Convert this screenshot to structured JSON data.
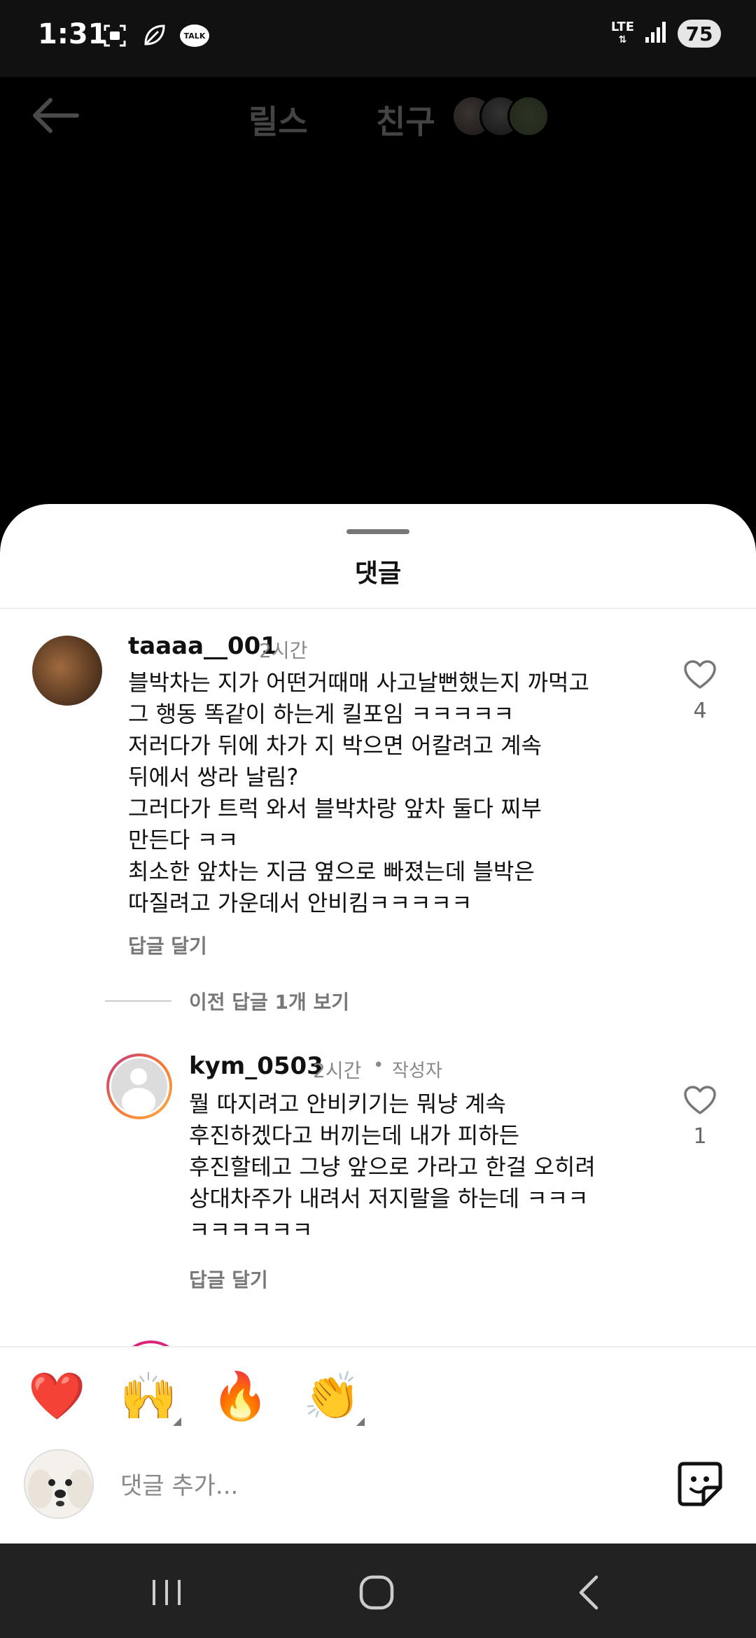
{
  "status_bar": {
    "time": "1:31",
    "talk_label": "TALK",
    "network": "LTE",
    "battery": "75"
  },
  "top_nav": {
    "reels_label": "릴스",
    "friends_label": "친구"
  },
  "sheet": {
    "title": "댓글"
  },
  "comments": [
    {
      "username": "taaaa__001",
      "time": "2시간",
      "text": "블박차는 지가 어떤거때매 사고날뻔했는지 까먹고\n그 행동 똑같이 하는게 킬포임 ㅋㅋㅋㅋㅋ\n저러다가 뒤에 차가 지 박으면 어칼려고 계속\n뒤에서 쌍라 날림?\n그러다가 트럭 와서 블박차랑 앞차 둘다 찌부\n만든다 ㅋㅋ\n최소한 앞차는 지금 옆으로 빠졌는데 블박은\n따질려고 가운데서 안비킴ㅋㅋㅋㅋㅋ",
      "reply_label": "답글 달기",
      "likes": "4"
    }
  ],
  "view_replies": "이전 답글 1개 보기",
  "reply": {
    "username": "kym_0503",
    "time": "2시간",
    "author_badge": "작성자",
    "text": "뭘 따지려고 안비키기는 뭐냥 계속\n후진하겠다고 버끼는데 내가 피하든\n후진할테고 그냥 앞으로 가라고 한걸 오히려\n상대차주가 내려서 저지랄을 하는데 ㅋㅋㅋ\nㅋㅋㅋㅋㅋㅋ",
    "reply_label": "답글 달기",
    "likes": "1"
  },
  "emoji_bar": [
    "❤️",
    "🙌",
    "🔥",
    "👏",
    "😢",
    "😍",
    "😮",
    "😂"
  ],
  "input": {
    "placeholder": "댓글 추가..."
  },
  "colors": {
    "like_red": "#ff3040",
    "story_ring": "#d9267a"
  }
}
